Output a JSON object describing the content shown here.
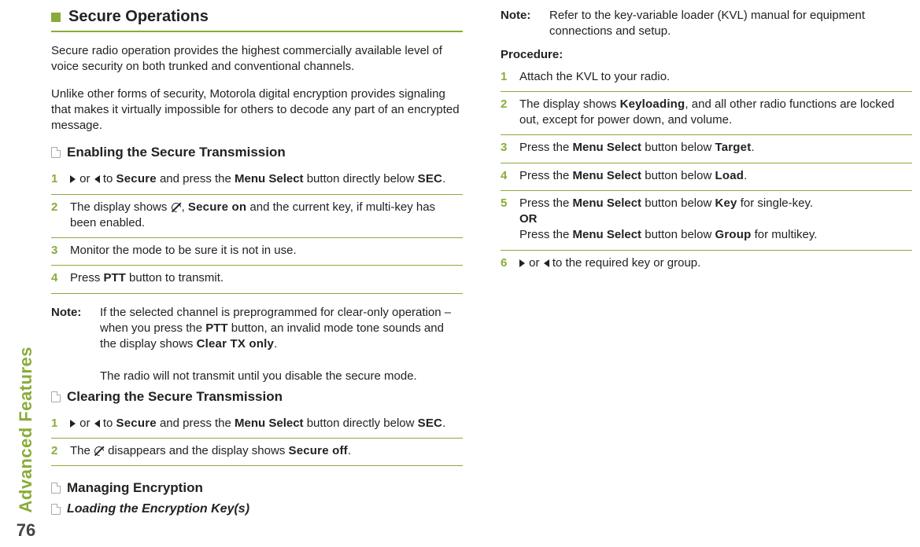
{
  "sidebar": {
    "label": "Advanced Features",
    "page": "76"
  },
  "secure_ops": {
    "title": "Secure Operations",
    "para1": "Secure radio operation provides the highest commercially available level of voice security on both trunked and conventional channels.",
    "para2": "Unlike other forms of security, Motorola digital encryption provides signaling that makes it virtually impossible for others to decode any part of an encrypted message."
  },
  "enable": {
    "heading": "Enabling the Secure Transmission",
    "step1_pre": " or ",
    "step1_mid": " to ",
    "step1_target": "Secure",
    "step1_after1": " and press the ",
    "step1_menu": "Menu Select",
    "step1_after2": " button directly below ",
    "step1_sec": "SEC",
    "step1_end": ".",
    "step2a": "The display shows ",
    "step2b": ", ",
    "step2_secureon": "Secure on",
    "step2c": " and the current key, if multi-key has been enabled.",
    "step3": "Monitor the mode to be sure it is not in use.",
    "step4a": "Press ",
    "step4_ptt": "PTT",
    "step4b": " button to transmit.",
    "note_label": "Note:",
    "note1a": "If the selected channel is preprogrammed for clear-only operation – when you press the ",
    "note1_ptt": "PTT",
    "note1b": " button, an invalid mode tone sounds and the display shows ",
    "note1_clear": "Clear TX only",
    "note1c": ".",
    "note2": "The radio will not transmit until you disable the secure mode."
  },
  "clear": {
    "heading": "Clearing the Secure Transmission",
    "step1_pre": " or ",
    "step1_mid": " to ",
    "step1_target": "Secure",
    "step1_after1": " and press the ",
    "step1_menu": "Menu Select",
    "step1_after2": " button directly below ",
    "step1_sec": "SEC",
    "step1_end": ".",
    "step2a": "The ",
    "step2b": " disappears and the display shows ",
    "step2_off": "Secure off",
    "step2c": "."
  },
  "manage": {
    "heading": "Managing Encryption",
    "sub_heading": "Loading the Encryption Key(s)",
    "note_label": "Note:",
    "note_text": "Refer to the key-variable loader (KVL) manual for equipment connections and setup.",
    "procedure_label": "Procedure:",
    "s1": "Attach the KVL to your radio.",
    "s2a": "The display shows ",
    "s2_key": "Keyloading",
    "s2b": ", and all other radio functions are locked out, except for power down, and volume.",
    "s3a": "Press the ",
    "s3_menu": "Menu Select",
    "s3b": " button below ",
    "s3_target": "Target",
    "s3c": ".",
    "s4a": "Press the ",
    "s4_menu": "Menu Select",
    "s4b": " button below ",
    "s4_load": "Load",
    "s4c": ".",
    "s5a": "Press the ",
    "s5_menu": "Menu Select",
    "s5b": " button below ",
    "s5_key": "Key",
    "s5c": " for single-key.",
    "s5_or": "OR",
    "s5d": "Press the ",
    "s5_menu2": "Menu Select",
    "s5e": " button below ",
    "s5_group": "Group",
    "s5f": " for multikey.",
    "s6_pre": " or ",
    "s6_after": " to the required key or group."
  }
}
